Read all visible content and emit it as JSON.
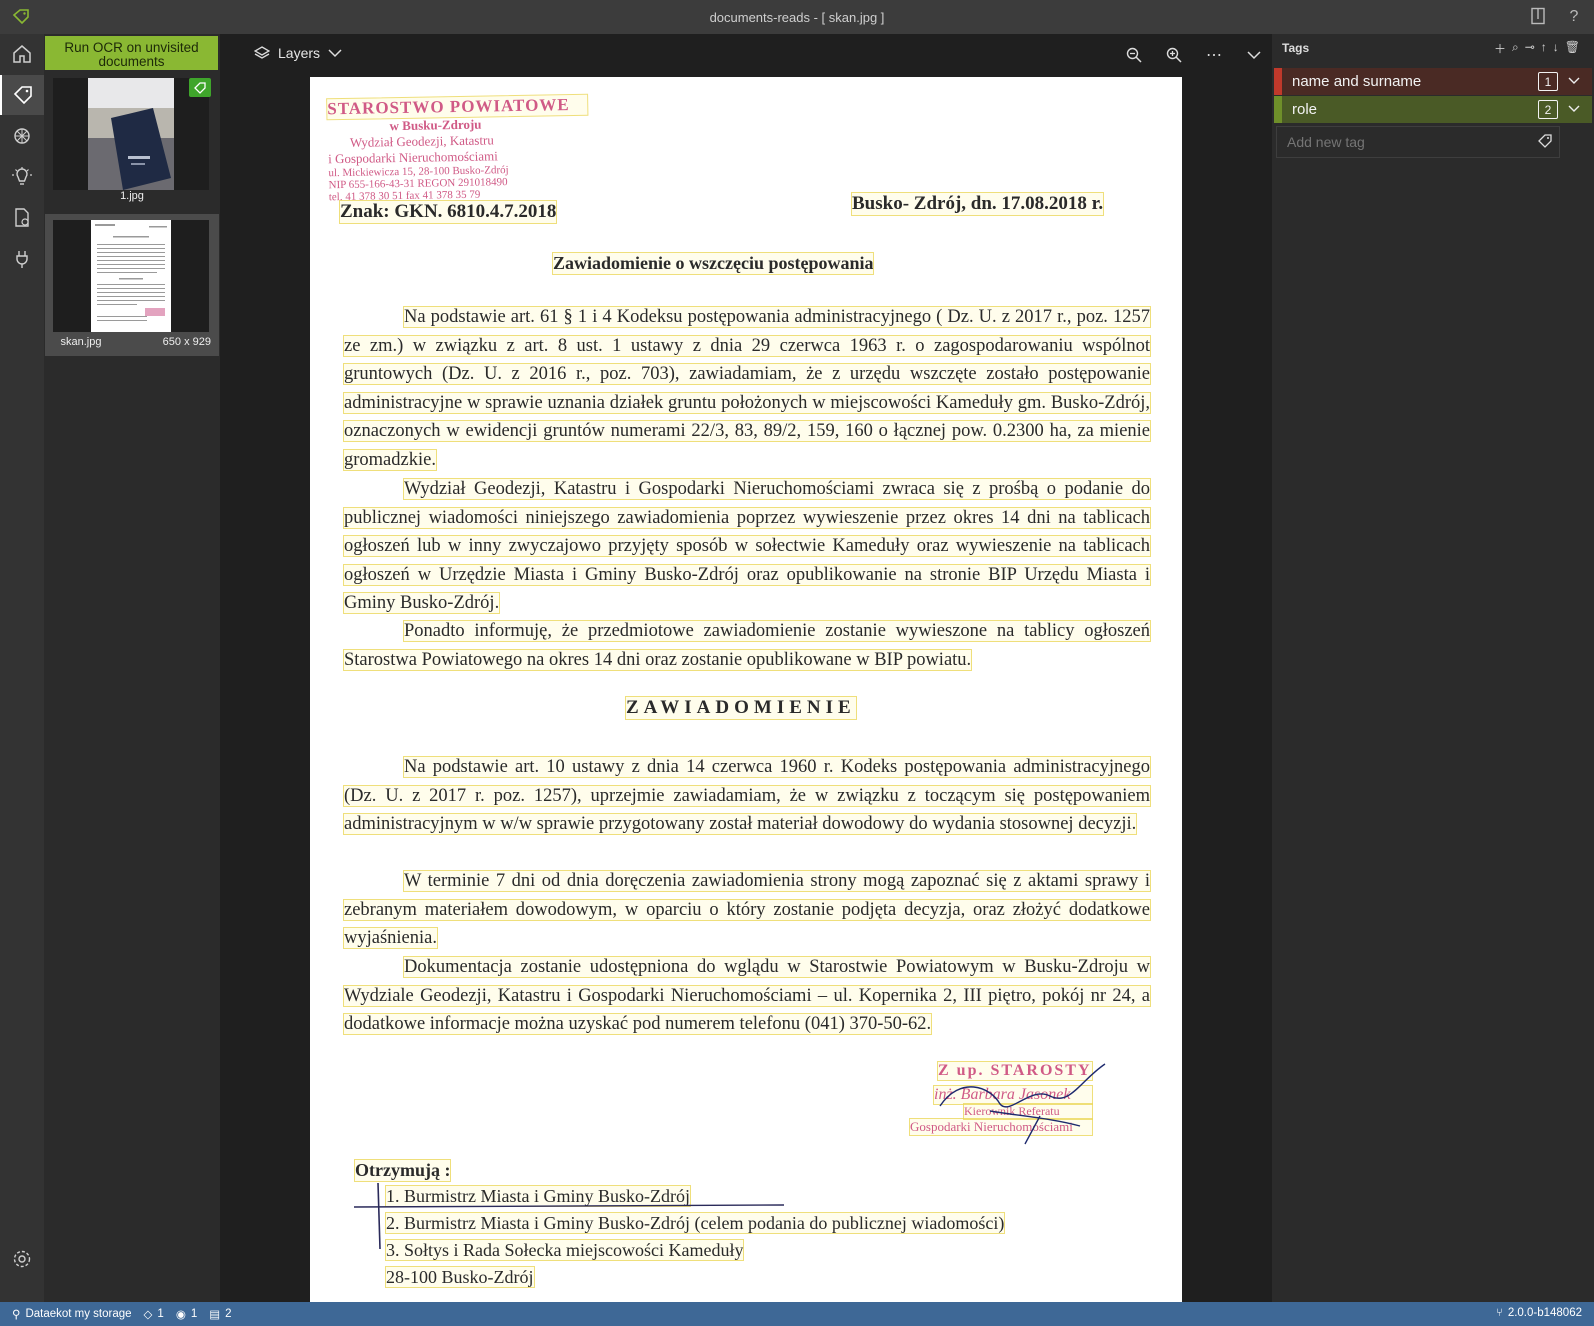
{
  "window": {
    "title": "documents-reads - [ skan.jpg ]",
    "accent": "#8ab833"
  },
  "sidebar": {
    "items": [
      {
        "icon": "home-icon"
      },
      {
        "icon": "tag-icon",
        "active": true
      },
      {
        "icon": "model-icon"
      },
      {
        "icon": "lightbulb-icon"
      },
      {
        "icon": "export-settings-icon"
      },
      {
        "icon": "plug-icon"
      },
      {
        "icon": "gear-icon"
      }
    ]
  },
  "thumbnails": {
    "ocr_button": "Run OCR on unvisited documents",
    "items": [
      {
        "name": "1.jpg",
        "tagged": true
      },
      {
        "name": "skan.jpg",
        "size": "650 x 929",
        "selected": true
      }
    ]
  },
  "toolbar": {
    "layers_label": "Layers"
  },
  "document": {
    "stamp": {
      "line1": "STAROSTWO POWIATOWE",
      "line2": "w Busku-Zdroju",
      "line3": "Wydział Geodezji, Katastru",
      "line4": "i Gospodarki Nieruchomościami",
      "line5": "ul. Mickiewicza 15, 28-100 Busko-Zdrój",
      "line6": "NIP 655-166-43-31  REGON 291018490",
      "line7": "tel. 41 378 30 51       fax 41 378 35 79"
    },
    "znak": "Znak: GKN. 6810.4.7.2018",
    "date": "Busko- Zdrój, dn. 17.08.2018 r.",
    "heading1": "Zawiadomienie o wszczęciu postępowania",
    "para1": "Na podstawie art. 61 § 1 i 4 Kodeksu postępowania administracyjnego ( Dz. U. z 2017 r., poz. 1257 ze zm.) w związku z art. 8 ust. 1 ustawy z dnia 29 czerwca 1963 r. o zagospodarowaniu wspólnot gruntowych (Dz. U. z 2016 r., poz. 703), zawiadamiam, że z urzędu wszczęte zostało postępowanie administracyjne w sprawie uznania działek gruntu położonych w miejscowości Kameduły gm. Busko-Zdrój, oznaczonych w ewidencji gruntów numerami 22/3, 83, 89/2, 159, 160 o łącznej pow. 0.2300 ha, za mienie gromadzkie.",
    "para2": "Wydział Geodezji, Katastru i Gospodarki Nieruchomościami zwraca się z prośbą o podanie do publicznej wiadomości niniejszego zawiadomienia poprzez wywieszenie przez okres 14 dni na tablicach ogłoszeń lub w inny zwyczajowo przyjęty sposób w sołectwie Kameduły oraz wywieszenie na tablicach ogłoszeń w Urzędzie Miasta i Gminy Busko-Zdrój oraz opublikowanie na stronie BIP Urzędu Miasta i Gminy Busko-Zdrój.",
    "para3": "Ponadto informuję, że przedmiotowe zawiadomienie zostanie wywieszone na tablicy ogłoszeń Starostwa Powiatowego na okres 14 dni oraz zostanie opublikowane w BIP powiatu.",
    "heading2": "ZAWIADOMIENIE",
    "para4": "Na podstawie art. 10 ustawy z dnia 14 czerwca 1960 r. Kodeks postępowania administracyjnego (Dz. U. z 2017 r. poz. 1257), uprzejmie zawiadamiam, że w związku z toczącym się postępowaniem administracyjnym w w/w sprawie przygotowany został materiał dowodowy do wydania stosownej decyzji.",
    "para5": "W terminie 7 dni od dnia doręczenia zawiadomienia strony mogą zapoznać się z aktami sprawy i zebranym materiałem dowodowym, w oparciu o który zostanie podjęta decyzja, oraz złożyć dodatkowe wyjaśnienia.",
    "para6": "Dokumentacja zostanie udostępniona do wglądu w Starostwie Powiatowym w Busku-Zdroju w Wydziale Geodezji, Katastru i Gospodarki Nieruchomościami – ul. Kopernika 2, III piętro, pokój nr 24, a dodatkowe informacje można uzyskać pod numerem telefonu (041) 370-50-62.",
    "signature": {
      "line1": "Z up. STAROSTY",
      "line2": "inż. Barbara Jasonek",
      "line3": "Kierownik Referatu",
      "line4": "Gospodarki Nieruchomościami"
    },
    "otrzymuja": "Otrzymują :",
    "recipients": [
      "1.   Burmistrz Miasta i Gminy Busko-Zdrój",
      "2.   Burmistrz Miasta i Gminy Busko-Zdrój (celem podania do publicznej wiadomości)",
      "3.   Sołtys i Rada Sołecka miejscowości Kameduły",
      "       28-100 Busko-Zdrój"
    ]
  },
  "tags": {
    "header": "Tags",
    "items": [
      {
        "label": "name and surname",
        "hotkey": "1",
        "color": "#c0392b"
      },
      {
        "label": "role",
        "hotkey": "2",
        "color": "#6f8f2a"
      }
    ],
    "add_placeholder": "Add new tag"
  },
  "statusbar": {
    "storage": "Dataekot my storage",
    "tagged_count": "1",
    "visited_count": "1",
    "doc_count": "2",
    "version": "2.0.0-b148062",
    "color": "#3e6896"
  }
}
